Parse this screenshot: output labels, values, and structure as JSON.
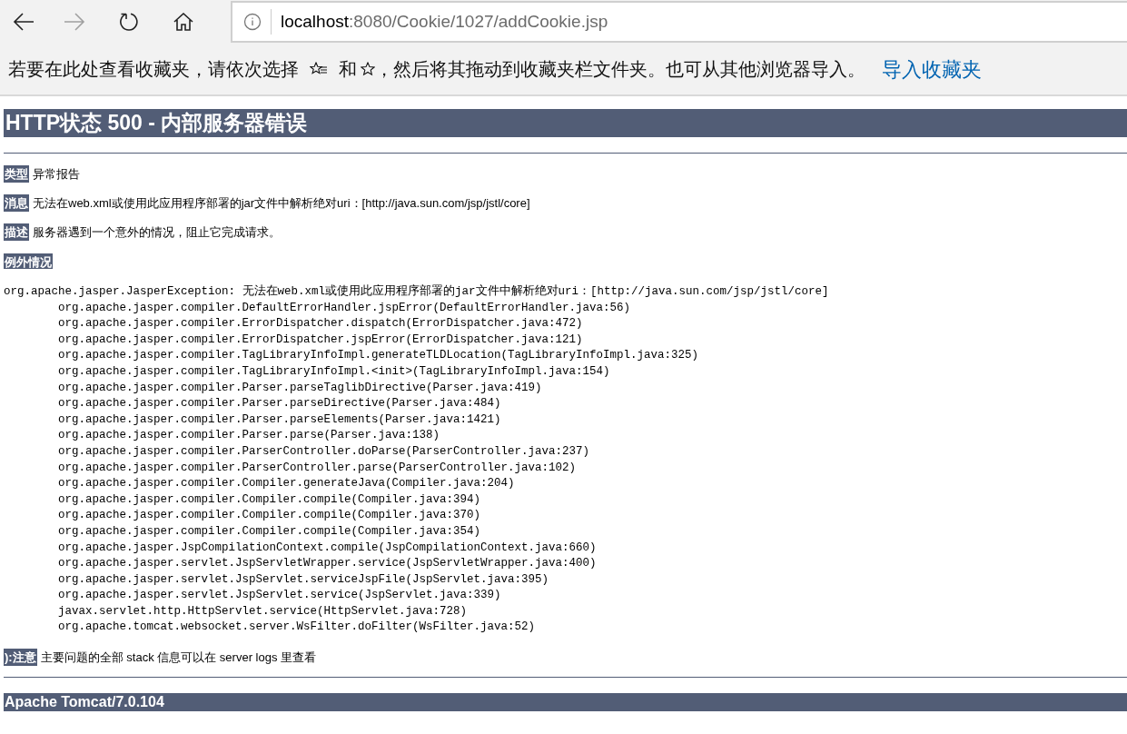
{
  "browser": {
    "back_disabled": false,
    "forward_disabled": true,
    "address": {
      "host": "localhost",
      "path": ":8080/Cookie/1027/addCookie.jsp"
    }
  },
  "favorites_bar": {
    "text_before": "若要在此处查看收藏夹，请依次选择",
    "text_middle": "和",
    "text_after": "，然后将其拖动到收藏夹栏文件夹。也可从其他浏览器导入。",
    "link": "导入收藏夹"
  },
  "page": {
    "title": "HTTP状态 500 - 内部服务器错误",
    "fields": [
      {
        "label": "类型",
        "value": "异常报告"
      },
      {
        "label": "消息",
        "value": "无法在web.xml或使用此应用程序部署的jar文件中解析绝对uri：[http://java.sun.com/jsp/jstl/core]"
      },
      {
        "label": "描述",
        "value": "服务器遇到一个意外的情况，阻止它完成请求。"
      }
    ],
    "exception_label": "例外情况",
    "exception": "org.apache.jasper.JasperException: 无法在web.xml或使用此应用程序部署的jar文件中解析绝对uri：[http://java.sun.com/jsp/jstl/core]",
    "stack": [
      "org.apache.jasper.compiler.DefaultErrorHandler.jspError(DefaultErrorHandler.java:56)",
      "org.apache.jasper.compiler.ErrorDispatcher.dispatch(ErrorDispatcher.java:472)",
      "org.apache.jasper.compiler.ErrorDispatcher.jspError(ErrorDispatcher.java:121)",
      "org.apache.jasper.compiler.TagLibraryInfoImpl.generateTLDLocation(TagLibraryInfoImpl.java:325)",
      "org.apache.jasper.compiler.TagLibraryInfoImpl.<init>(TagLibraryInfoImpl.java:154)",
      "org.apache.jasper.compiler.Parser.parseTaglibDirective(Parser.java:419)",
      "org.apache.jasper.compiler.Parser.parseDirective(Parser.java:484)",
      "org.apache.jasper.compiler.Parser.parseElements(Parser.java:1421)",
      "org.apache.jasper.compiler.Parser.parse(Parser.java:138)",
      "org.apache.jasper.compiler.ParserController.doParse(ParserController.java:237)",
      "org.apache.jasper.compiler.ParserController.parse(ParserController.java:102)",
      "org.apache.jasper.compiler.Compiler.generateJava(Compiler.java:204)",
      "org.apache.jasper.compiler.Compiler.compile(Compiler.java:394)",
      "org.apache.jasper.compiler.Compiler.compile(Compiler.java:370)",
      "org.apache.jasper.compiler.Compiler.compile(Compiler.java:354)",
      "org.apache.jasper.JspCompilationContext.compile(JspCompilationContext.java:660)",
      "org.apache.jasper.servlet.JspServletWrapper.service(JspServletWrapper.java:400)",
      "org.apache.jasper.servlet.JspServlet.serviceJspFile(JspServlet.java:395)",
      "org.apache.jasper.servlet.JspServlet.service(JspServlet.java:339)",
      "javax.servlet.http.HttpServlet.service(HttpServlet.java:728)",
      "org.apache.tomcat.websocket.server.WsFilter.doFilter(WsFilter.java:52)"
    ],
    "note": {
      "label": "):注意",
      "text": "主要问题的全部 stack 信息可以在 server logs 里查看"
    },
    "footer": "Apache Tomcat/7.0.104"
  }
}
